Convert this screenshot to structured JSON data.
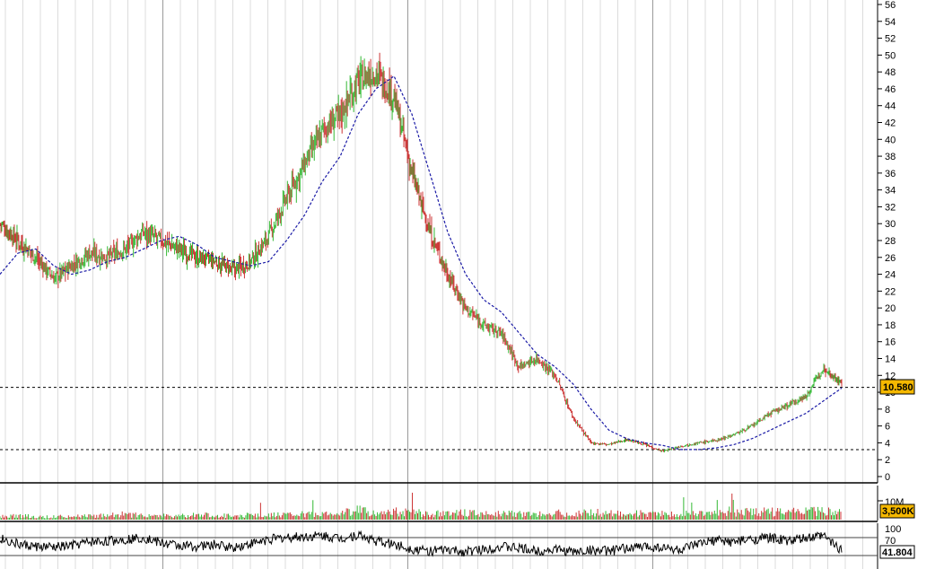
{
  "chart_data": [
    {
      "type": "candlestick",
      "panel": "price",
      "ylim": [
        0,
        56
      ],
      "y_ticks": [
        "0",
        "2",
        "4",
        "6",
        "8",
        "10",
        "12",
        "14",
        "16",
        "18",
        "20",
        "22",
        "24",
        "26",
        "28",
        "30",
        "32",
        "34",
        "36",
        "38",
        "40",
        "42",
        "44",
        "46",
        "48",
        "50",
        "52",
        "54",
        "56"
      ],
      "last_price_label": "10.580",
      "last_price": 10.58,
      "reference_lines": [
        10.58,
        3.2
      ],
      "series": [
        {
          "kind": "price",
          "up_color": "#33b833",
          "down_color": "#cc3333",
          "x": [
            0,
            20,
            40,
            60,
            80,
            100,
            120,
            140,
            160,
            180,
            200,
            220,
            240,
            260,
            280,
            300,
            320,
            340,
            360,
            380,
            400,
            420,
            440,
            460,
            480,
            500,
            520,
            540,
            560,
            580,
            600,
            620,
            640,
            660,
            680,
            700,
            720,
            740,
            760,
            780,
            800,
            820,
            840,
            860,
            880,
            900,
            920,
            940
          ],
          "values": [
            30,
            28,
            26,
            23.5,
            25,
            26.5,
            26,
            27,
            29,
            28,
            27,
            26,
            25.5,
            24.5,
            25.5,
            28.5,
            33,
            37,
            41,
            43,
            47,
            48,
            45,
            36,
            29,
            24,
            20,
            18,
            17,
            13,
            14,
            12,
            7,
            4,
            3.8,
            4.4,
            3.8,
            3,
            3.6,
            4,
            4.3,
            5,
            6,
            7.5,
            8.5,
            9.5,
            13,
            11
          ]
        },
        {
          "kind": "moving_average",
          "color": "#1a1aa6",
          "x": [
            0,
            20,
            40,
            60,
            80,
            100,
            120,
            140,
            160,
            180,
            200,
            220,
            240,
            260,
            280,
            300,
            320,
            340,
            360,
            380,
            400,
            420,
            440,
            460,
            480,
            500,
            520,
            540,
            560,
            580,
            600,
            620,
            640,
            660,
            680,
            700,
            720,
            740,
            760,
            780,
            800,
            820,
            840,
            860,
            880,
            900,
            920,
            940
          ],
          "values": [
            24,
            26.5,
            27,
            25,
            24,
            24.5,
            25.5,
            26,
            27,
            28,
            28.5,
            27.5,
            26,
            25.5,
            25,
            25.5,
            28,
            31,
            35,
            38,
            43,
            46,
            47.5,
            43,
            36,
            29,
            24,
            21,
            19.5,
            17,
            14.5,
            13,
            11,
            8,
            5.5,
            4.5,
            4,
            3.7,
            3.2,
            3.2,
            3.4,
            3.8,
            4.5,
            5.5,
            6.5,
            7.5,
            9,
            10.5
          ]
        }
      ]
    },
    {
      "type": "bar",
      "panel": "volume",
      "y_ticks": [
        "10M"
      ],
      "last_label": "3,500K",
      "max": 10000,
      "x": [
        0,
        20,
        40,
        60,
        80,
        100,
        120,
        140,
        160,
        180,
        200,
        220,
        240,
        260,
        280,
        300,
        320,
        340,
        360,
        380,
        400,
        420,
        440,
        460,
        480,
        500,
        520,
        540,
        560,
        580,
        600,
        620,
        640,
        660,
        680,
        700,
        720,
        740,
        760,
        780,
        800,
        820,
        840,
        860,
        880,
        900,
        920,
        940
      ],
      "values": [
        1200,
        1500,
        1000,
        1100,
        1300,
        1200,
        1600,
        1900,
        1500,
        1400,
        1300,
        1700,
        1500,
        1400,
        1600,
        1800,
        1700,
        2000,
        1800,
        2300,
        3500,
        2000,
        2800,
        2500,
        2200,
        2100,
        2500,
        2200,
        2300,
        2100,
        1900,
        2300,
        2200,
        2500,
        2300,
        2000,
        2200,
        2100,
        2000,
        2100,
        2200,
        2400,
        3000,
        2800,
        2600,
        2900,
        3100,
        2800
      ]
    },
    {
      "type": "line",
      "panel": "oscillator",
      "y_ticks": [
        "100",
        "70"
      ],
      "last_label": "41.804",
      "levels": [
        70,
        30
      ],
      "ylim": [
        0,
        100
      ],
      "x": [
        0,
        20,
        40,
        60,
        80,
        100,
        120,
        140,
        160,
        180,
        200,
        220,
        240,
        260,
        280,
        300,
        320,
        340,
        360,
        380,
        400,
        420,
        440,
        460,
        480,
        500,
        520,
        540,
        560,
        580,
        600,
        620,
        640,
        660,
        680,
        700,
        720,
        740,
        760,
        780,
        800,
        820,
        840,
        860,
        880,
        900,
        920,
        940
      ],
      "values": [
        68,
        55,
        50,
        48,
        52,
        60,
        62,
        66,
        70,
        58,
        52,
        50,
        54,
        48,
        56,
        66,
        70,
        72,
        74,
        68,
        76,
        62,
        55,
        45,
        40,
        42,
        38,
        44,
        50,
        46,
        40,
        44,
        38,
        42,
        40,
        46,
        50,
        48,
        42,
        55,
        64,
        60,
        66,
        70,
        62,
        68,
        74,
        41.8
      ]
    }
  ]
}
